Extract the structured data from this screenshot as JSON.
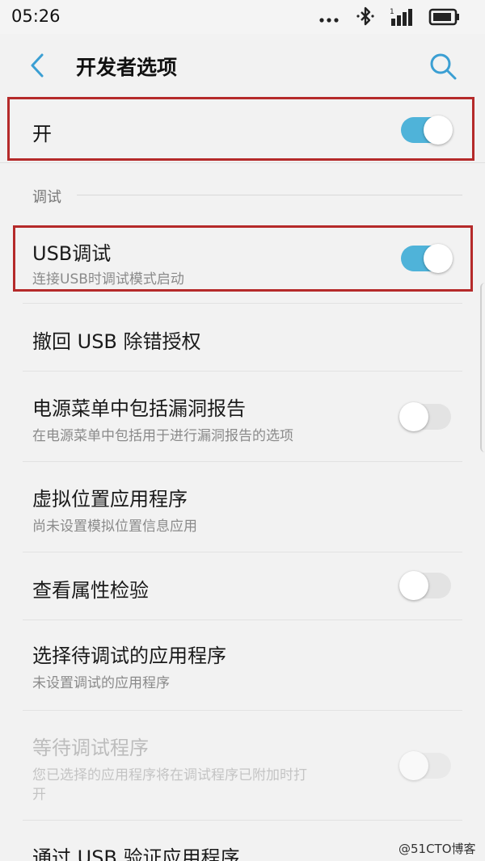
{
  "status_bar": {
    "time": "05:26",
    "icons": [
      "more-dots-icon",
      "bluetooth-icon",
      "signal-icon",
      "battery-icon"
    ]
  },
  "nav": {
    "title": "开发者选项",
    "back_icon": "chevron-left-icon",
    "search_icon": "search-icon"
  },
  "colors": {
    "accent": "#4fb3d9",
    "highlight_border": "#b52a2a"
  },
  "master": {
    "label": "开",
    "enabled": true
  },
  "section": {
    "header": "调试"
  },
  "items": [
    {
      "title": "USB调试",
      "subtitle": "连接USB时调试模式启动",
      "toggle": "on",
      "disabled": false
    },
    {
      "title": "撤回 USB 除错授权",
      "subtitle": "",
      "toggle": "none",
      "disabled": false
    },
    {
      "title": "电源菜单中包括漏洞报告",
      "subtitle": "在电源菜单中包括用于进行漏洞报告的选项",
      "toggle": "off",
      "disabled": false
    },
    {
      "title": "虚拟位置应用程序",
      "subtitle": "尚未设置模拟位置信息应用",
      "toggle": "none",
      "disabled": false
    },
    {
      "title": "查看属性检验",
      "subtitle": "",
      "toggle": "off",
      "disabled": false
    },
    {
      "title": "选择待调试的应用程序",
      "subtitle": "未设置调试的应用程序",
      "toggle": "none",
      "disabled": false
    },
    {
      "title": "等待调试程序",
      "subtitle": "您已选择的应用程序将在调试程序已附加时打",
      "subtitle_line2": "开",
      "toggle": "off",
      "disabled": true
    },
    {
      "title": "通过 USB 验证应用程序",
      "subtitle": "",
      "toggle": "none",
      "disabled": false
    }
  ],
  "watermark": "@51CTO博客"
}
